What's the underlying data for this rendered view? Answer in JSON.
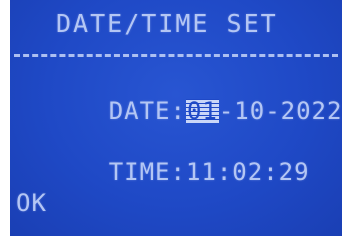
{
  "screen": {
    "title": "DATE/TIME SET",
    "colors": {
      "background": "#1f49c6",
      "text": "#b4c6f4"
    }
  },
  "date": {
    "label": "DATE:",
    "day": "01",
    "rest": "-10-2022"
  },
  "time": {
    "label": "TIME:",
    "value": "11:02:29"
  },
  "ok": {
    "label": "OK"
  }
}
